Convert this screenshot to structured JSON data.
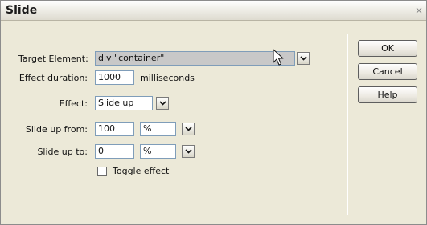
{
  "window": {
    "title": "Slide",
    "close_glyph": "×"
  },
  "form": {
    "target_element": {
      "label": "Target Element:",
      "value": "div \"container\""
    },
    "effect_duration": {
      "label": "Effect duration:",
      "value": "1000",
      "unit": "milliseconds"
    },
    "effect": {
      "label": "Effect:",
      "value": "Slide up"
    },
    "slide_up_from": {
      "label": "Slide up from:",
      "value": "100",
      "unit": "%"
    },
    "slide_up_to": {
      "label": "Slide up to:",
      "value": "0",
      "unit": "%"
    },
    "toggle_effect": {
      "label": "Toggle effect",
      "checked": false
    }
  },
  "buttons": {
    "ok": "OK",
    "cancel": "Cancel",
    "help": "Help"
  },
  "icons": {
    "dropdown": "chevron-down-icon",
    "cursor": "mouse-pointer-icon",
    "close": "close-icon"
  },
  "colors": {
    "window_bg": "#ece9d8",
    "target_field_bg": "#c8c8c8",
    "field_border": "#7f9db9"
  }
}
